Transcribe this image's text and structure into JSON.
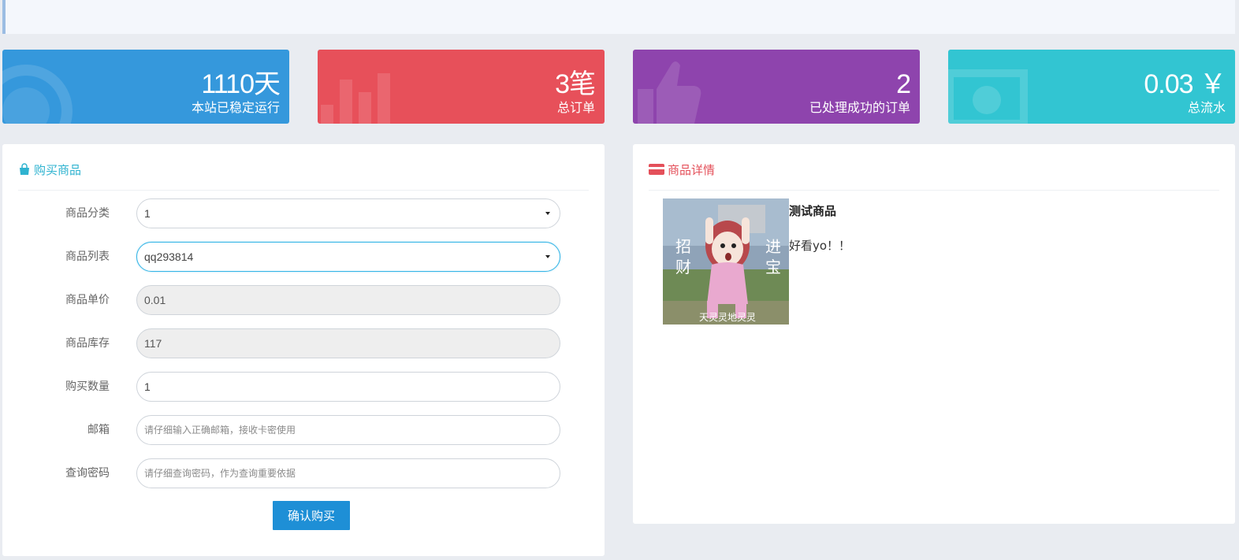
{
  "colors": {
    "card_blue": "#3598dc",
    "card_red": "#e7505a",
    "card_purple": "#8e44ad",
    "card_teal": "#32c5d2",
    "buy_title": "#2fb3d0",
    "detail_title": "#e4505a",
    "submit_button": "#1e8fd6"
  },
  "stats": [
    {
      "value": "1110天",
      "label": "本站已稳定运行",
      "icon": "circle-icon"
    },
    {
      "value": "3笔",
      "label": "总订单",
      "icon": "bar-chart-icon"
    },
    {
      "value": "2",
      "label": "已处理成功的订单",
      "icon": "thumbs-up-icon"
    },
    {
      "value": "0.03 ￥",
      "label": "总流水",
      "icon": "money-icon"
    }
  ],
  "buy_panel": {
    "title": "购买商品",
    "icon": "shopping-bag-icon",
    "fields": {
      "category": {
        "label": "商品分类",
        "value": "1"
      },
      "product": {
        "label": "商品列表",
        "value": "qq293814"
      },
      "price": {
        "label": "商品单价",
        "value": "0.01"
      },
      "stock": {
        "label": "商品库存",
        "value": "117"
      },
      "quantity": {
        "label": "购买数量",
        "value": "1"
      },
      "email": {
        "label": "邮箱",
        "placeholder": "请仔细输入正确邮箱，接收卡密使用"
      },
      "password": {
        "label": "查询密码",
        "placeholder": "请仔细查询密码，作为查询重要依据"
      }
    },
    "submit_label": "确认购买"
  },
  "detail_panel": {
    "title": "商品详情",
    "icon": "credit-card-icon",
    "product_name": "测试商品",
    "product_description": "好看yo！！",
    "image": {
      "left_text": "招财",
      "right_text": "进宝",
      "bottom_text": "天灵灵地灵灵"
    }
  }
}
